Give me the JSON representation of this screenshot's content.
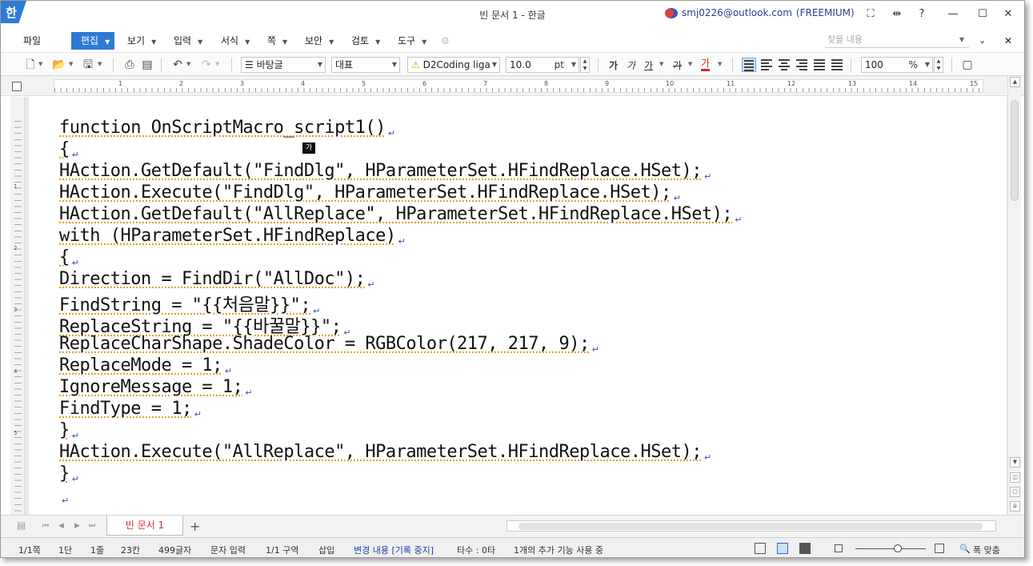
{
  "app": {
    "logo": "한",
    "title": "빈 문서 1 - 한글"
  },
  "account": {
    "email": "smj0226@outlook.com",
    "plan": "(FREEMIUM)"
  },
  "window_controls": {
    "fullscreen": "⛶",
    "layout": "⇹",
    "help": "?",
    "minimize": "—",
    "maximize": "☐",
    "close": "✕"
  },
  "menu": {
    "items": [
      "파일",
      "편집",
      "보기",
      "입력",
      "서식",
      "쪽",
      "보안",
      "검토",
      "도구"
    ],
    "active": "편집",
    "find_placeholder": "찾을 내용"
  },
  "toolbar": {
    "style": "바탕글",
    "font_lang": "대표",
    "font_name": "D2Coding liga",
    "font_size": "10.0",
    "font_unit": "pt",
    "format_bold": "가",
    "format_italic": "가",
    "format_underline": "가",
    "format_strike": "가",
    "format_color": "가",
    "zoom": "100",
    "zoom_unit": "%"
  },
  "ruler": {
    "numbers": [
      "1",
      "2",
      "3",
      "4",
      "5",
      "6",
      "7",
      "8",
      "9",
      "10",
      "11",
      "12",
      "13",
      "14",
      "15"
    ]
  },
  "vruler": {
    "numbers": [
      "1",
      "2",
      "3",
      "4",
      "5"
    ]
  },
  "document": {
    "ime_indicator": "가",
    "lines": [
      "function OnScriptMacro_script1()",
      "{",
      "HAction.GetDefault(\"FindDlg\", HParameterSet.HFindReplace.HSet);",
      "HAction.Execute(\"FindDlg\", HParameterSet.HFindReplace.HSet);",
      "HAction.GetDefault(\"AllReplace\", HParameterSet.HFindReplace.HSet);",
      "with (HParameterSet.HFindReplace)",
      "{",
      "Direction = FindDir(\"AllDoc\");",
      "FindString = \"{{처음말}}\";",
      "ReplaceString = \"{{바꿀말}}\";",
      "ReplaceCharShape.ShadeColor = RGBColor(217, 217, 9);",
      "ReplaceMode = 1;",
      "IgnoreMessage = 1;",
      "FindType = 1;",
      "}",
      "HAction.Execute(\"AllReplace\", HParameterSet.HFindReplace.HSet);",
      "}",
      ""
    ],
    "para_mark": "↵"
  },
  "tabs": {
    "doc_tab": "빈 문서 1",
    "add": "+"
  },
  "status": {
    "page": "1/1쪽",
    "column": "1단",
    "line": "1줄",
    "col": "23칸",
    "chars": "499글자",
    "input_mode": "문자 입력",
    "section": "1/1 구역",
    "insert": "삽입",
    "track_changes": "변경 내용 [기록 중지]",
    "keystrokes": "타수 : 0타",
    "addons": "1개의 추가 기능 사용 중",
    "fit_width": "폭 맞춤"
  },
  "colors": {
    "accent": "#2d7ad6",
    "tab_text": "#d0312d",
    "para_mark": "#3355bb"
  }
}
